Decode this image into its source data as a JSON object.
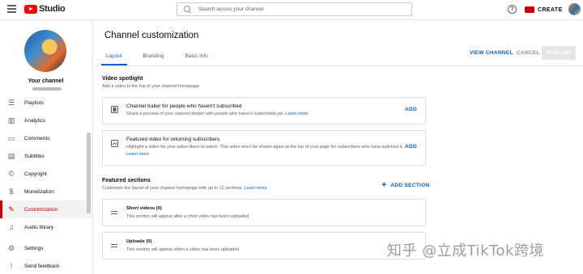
{
  "app": {
    "logo_text": "Studio"
  },
  "search": {
    "placeholder": "Search across your channel"
  },
  "header": {
    "help_label": "?",
    "create_label": "CREATE"
  },
  "sidebar": {
    "channel_label": "Your channel",
    "items": [
      {
        "label": "Playlists",
        "icon": "playlist-icon",
        "glyph": "☰"
      },
      {
        "label": "Analytics",
        "icon": "analytics-icon",
        "glyph": "▥"
      },
      {
        "label": "Comments",
        "icon": "comments-icon",
        "glyph": "▭"
      },
      {
        "label": "Subtitles",
        "icon": "subtitles-icon",
        "glyph": "▤"
      },
      {
        "label": "Copyright",
        "icon": "copyright-icon",
        "glyph": "©"
      },
      {
        "label": "Monetization",
        "icon": "monetization-icon",
        "glyph": "$"
      },
      {
        "label": "Customization",
        "icon": "customization-icon",
        "glyph": "✎",
        "active": true
      },
      {
        "label": "Audio library",
        "icon": "audio-library-icon",
        "glyph": "♫"
      }
    ],
    "footer": [
      {
        "label": "Settings",
        "icon": "settings-icon",
        "glyph": "⚙"
      },
      {
        "label": "Send feedback",
        "icon": "feedback-icon",
        "glyph": "!"
      }
    ]
  },
  "page": {
    "title": "Channel customization",
    "tabs": [
      "Layout",
      "Branding",
      "Basic info"
    ],
    "active_tab": "Layout",
    "view_channel": "VIEW CHANNEL",
    "cancel": "CANCEL",
    "publish": "PUBLISH"
  },
  "spotlight": {
    "title": "Video spotlight",
    "desc": "Add a video to the top of your channel homepage",
    "trailer": {
      "title": "Channel trailer for people who haven't subscribed",
      "desc": "Share a preview of your channel shown with people who haven't subscribed yet.",
      "learn_more": "Learn more",
      "add": "ADD"
    },
    "featured": {
      "title": "Featured video for returning subscribers",
      "desc": "Highlight a video for your subscribers to watch. This video won't be shown again at the top of your page for subscribers who have watched it.",
      "learn_more": "Learn more",
      "add": "ADD"
    }
  },
  "featured_sections": {
    "title": "Featured sections",
    "desc": "Customize the layout of your channel homepage with up to 12 sections.",
    "learn_more": "Learn more",
    "add_section": "ADD SECTION",
    "sections": [
      {
        "title": "Short videos (0)",
        "desc": "This section will appear after a short video has been uploaded"
      },
      {
        "title": "Uploads (0)",
        "desc": "This section will appear when a video has been uploaded"
      }
    ]
  },
  "watermark": "知乎 @立成TikTok跨境",
  "colors": {
    "accent": "#065fd4",
    "brand": "#ff0000",
    "active": "#cc0000"
  }
}
